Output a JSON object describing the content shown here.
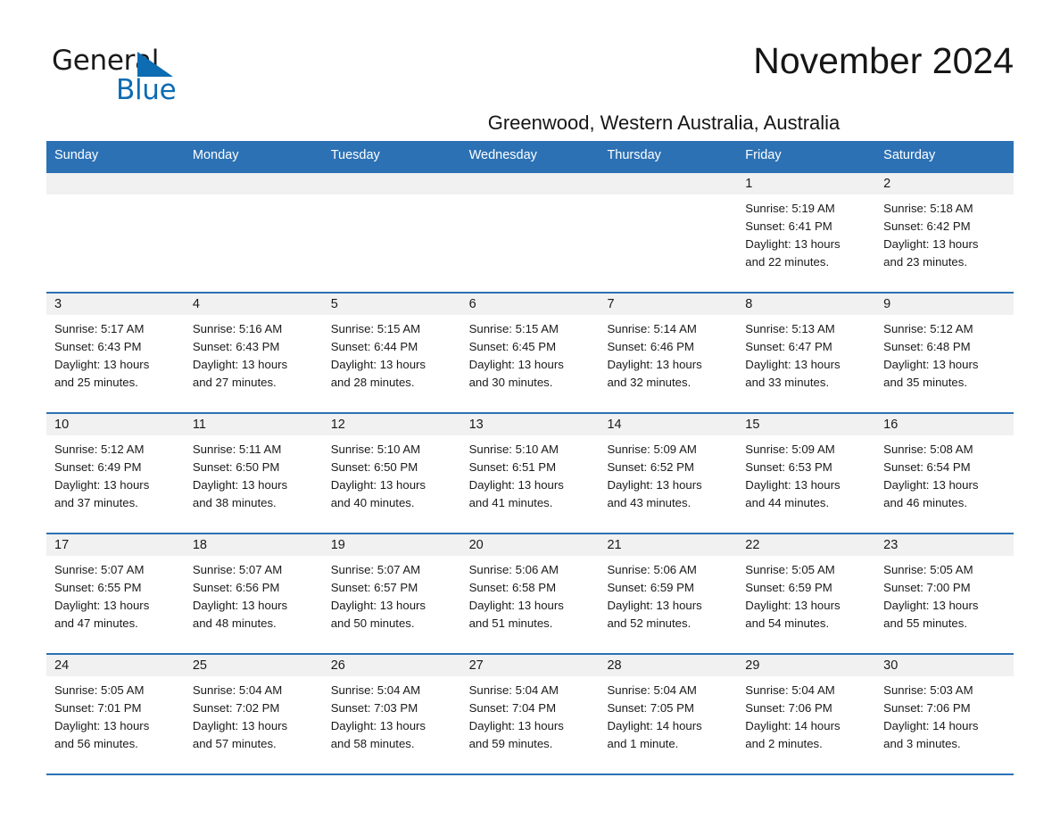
{
  "logo": {
    "text_primary": "General",
    "text_secondary": "Blue",
    "triangle_color": "#0d6cb2"
  },
  "header": {
    "title": "November 2024",
    "subtitle": "Greenwood, Western Australia, Australia",
    "accent_color": "#2c71b4",
    "band_color": "#f1f1f1"
  },
  "weekdays": [
    "Sunday",
    "Monday",
    "Tuesday",
    "Wednesday",
    "Thursday",
    "Friday",
    "Saturday"
  ],
  "weeks": [
    [
      {
        "day": "",
        "sunrise": "",
        "sunset": "",
        "daylight_line1": "",
        "daylight_line2": ""
      },
      {
        "day": "",
        "sunrise": "",
        "sunset": "",
        "daylight_line1": "",
        "daylight_line2": ""
      },
      {
        "day": "",
        "sunrise": "",
        "sunset": "",
        "daylight_line1": "",
        "daylight_line2": ""
      },
      {
        "day": "",
        "sunrise": "",
        "sunset": "",
        "daylight_line1": "",
        "daylight_line2": ""
      },
      {
        "day": "",
        "sunrise": "",
        "sunset": "",
        "daylight_line1": "",
        "daylight_line2": ""
      },
      {
        "day": "1",
        "sunrise": "Sunrise: 5:19 AM",
        "sunset": "Sunset: 6:41 PM",
        "daylight_line1": "Daylight: 13 hours",
        "daylight_line2": "and 22 minutes."
      },
      {
        "day": "2",
        "sunrise": "Sunrise: 5:18 AM",
        "sunset": "Sunset: 6:42 PM",
        "daylight_line1": "Daylight: 13 hours",
        "daylight_line2": "and 23 minutes."
      }
    ],
    [
      {
        "day": "3",
        "sunrise": "Sunrise: 5:17 AM",
        "sunset": "Sunset: 6:43 PM",
        "daylight_line1": "Daylight: 13 hours",
        "daylight_line2": "and 25 minutes."
      },
      {
        "day": "4",
        "sunrise": "Sunrise: 5:16 AM",
        "sunset": "Sunset: 6:43 PM",
        "daylight_line1": "Daylight: 13 hours",
        "daylight_line2": "and 27 minutes."
      },
      {
        "day": "5",
        "sunrise": "Sunrise: 5:15 AM",
        "sunset": "Sunset: 6:44 PM",
        "daylight_line1": "Daylight: 13 hours",
        "daylight_line2": "and 28 minutes."
      },
      {
        "day": "6",
        "sunrise": "Sunrise: 5:15 AM",
        "sunset": "Sunset: 6:45 PM",
        "daylight_line1": "Daylight: 13 hours",
        "daylight_line2": "and 30 minutes."
      },
      {
        "day": "7",
        "sunrise": "Sunrise: 5:14 AM",
        "sunset": "Sunset: 6:46 PM",
        "daylight_line1": "Daylight: 13 hours",
        "daylight_line2": "and 32 minutes."
      },
      {
        "day": "8",
        "sunrise": "Sunrise: 5:13 AM",
        "sunset": "Sunset: 6:47 PM",
        "daylight_line1": "Daylight: 13 hours",
        "daylight_line2": "and 33 minutes."
      },
      {
        "day": "9",
        "sunrise": "Sunrise: 5:12 AM",
        "sunset": "Sunset: 6:48 PM",
        "daylight_line1": "Daylight: 13 hours",
        "daylight_line2": "and 35 minutes."
      }
    ],
    [
      {
        "day": "10",
        "sunrise": "Sunrise: 5:12 AM",
        "sunset": "Sunset: 6:49 PM",
        "daylight_line1": "Daylight: 13 hours",
        "daylight_line2": "and 37 minutes."
      },
      {
        "day": "11",
        "sunrise": "Sunrise: 5:11 AM",
        "sunset": "Sunset: 6:50 PM",
        "daylight_line1": "Daylight: 13 hours",
        "daylight_line2": "and 38 minutes."
      },
      {
        "day": "12",
        "sunrise": "Sunrise: 5:10 AM",
        "sunset": "Sunset: 6:50 PM",
        "daylight_line1": "Daylight: 13 hours",
        "daylight_line2": "and 40 minutes."
      },
      {
        "day": "13",
        "sunrise": "Sunrise: 5:10 AM",
        "sunset": "Sunset: 6:51 PM",
        "daylight_line1": "Daylight: 13 hours",
        "daylight_line2": "and 41 minutes."
      },
      {
        "day": "14",
        "sunrise": "Sunrise: 5:09 AM",
        "sunset": "Sunset: 6:52 PM",
        "daylight_line1": "Daylight: 13 hours",
        "daylight_line2": "and 43 minutes."
      },
      {
        "day": "15",
        "sunrise": "Sunrise: 5:09 AM",
        "sunset": "Sunset: 6:53 PM",
        "daylight_line1": "Daylight: 13 hours",
        "daylight_line2": "and 44 minutes."
      },
      {
        "day": "16",
        "sunrise": "Sunrise: 5:08 AM",
        "sunset": "Sunset: 6:54 PM",
        "daylight_line1": "Daylight: 13 hours",
        "daylight_line2": "and 46 minutes."
      }
    ],
    [
      {
        "day": "17",
        "sunrise": "Sunrise: 5:07 AM",
        "sunset": "Sunset: 6:55 PM",
        "daylight_line1": "Daylight: 13 hours",
        "daylight_line2": "and 47 minutes."
      },
      {
        "day": "18",
        "sunrise": "Sunrise: 5:07 AM",
        "sunset": "Sunset: 6:56 PM",
        "daylight_line1": "Daylight: 13 hours",
        "daylight_line2": "and 48 minutes."
      },
      {
        "day": "19",
        "sunrise": "Sunrise: 5:07 AM",
        "sunset": "Sunset: 6:57 PM",
        "daylight_line1": "Daylight: 13 hours",
        "daylight_line2": "and 50 minutes."
      },
      {
        "day": "20",
        "sunrise": "Sunrise: 5:06 AM",
        "sunset": "Sunset: 6:58 PM",
        "daylight_line1": "Daylight: 13 hours",
        "daylight_line2": "and 51 minutes."
      },
      {
        "day": "21",
        "sunrise": "Sunrise: 5:06 AM",
        "sunset": "Sunset: 6:59 PM",
        "daylight_line1": "Daylight: 13 hours",
        "daylight_line2": "and 52 minutes."
      },
      {
        "day": "22",
        "sunrise": "Sunrise: 5:05 AM",
        "sunset": "Sunset: 6:59 PM",
        "daylight_line1": "Daylight: 13 hours",
        "daylight_line2": "and 54 minutes."
      },
      {
        "day": "23",
        "sunrise": "Sunrise: 5:05 AM",
        "sunset": "Sunset: 7:00 PM",
        "daylight_line1": "Daylight: 13 hours",
        "daylight_line2": "and 55 minutes."
      }
    ],
    [
      {
        "day": "24",
        "sunrise": "Sunrise: 5:05 AM",
        "sunset": "Sunset: 7:01 PM",
        "daylight_line1": "Daylight: 13 hours",
        "daylight_line2": "and 56 minutes."
      },
      {
        "day": "25",
        "sunrise": "Sunrise: 5:04 AM",
        "sunset": "Sunset: 7:02 PM",
        "daylight_line1": "Daylight: 13 hours",
        "daylight_line2": "and 57 minutes."
      },
      {
        "day": "26",
        "sunrise": "Sunrise: 5:04 AM",
        "sunset": "Sunset: 7:03 PM",
        "daylight_line1": "Daylight: 13 hours",
        "daylight_line2": "and 58 minutes."
      },
      {
        "day": "27",
        "sunrise": "Sunrise: 5:04 AM",
        "sunset": "Sunset: 7:04 PM",
        "daylight_line1": "Daylight: 13 hours",
        "daylight_line2": "and 59 minutes."
      },
      {
        "day": "28",
        "sunrise": "Sunrise: 5:04 AM",
        "sunset": "Sunset: 7:05 PM",
        "daylight_line1": "Daylight: 14 hours",
        "daylight_line2": "and 1 minute."
      },
      {
        "day": "29",
        "sunrise": "Sunrise: 5:04 AM",
        "sunset": "Sunset: 7:06 PM",
        "daylight_line1": "Daylight: 14 hours",
        "daylight_line2": "and 2 minutes."
      },
      {
        "day": "30",
        "sunrise": "Sunrise: 5:03 AM",
        "sunset": "Sunset: 7:06 PM",
        "daylight_line1": "Daylight: 14 hours",
        "daylight_line2": "and 3 minutes."
      }
    ]
  ]
}
